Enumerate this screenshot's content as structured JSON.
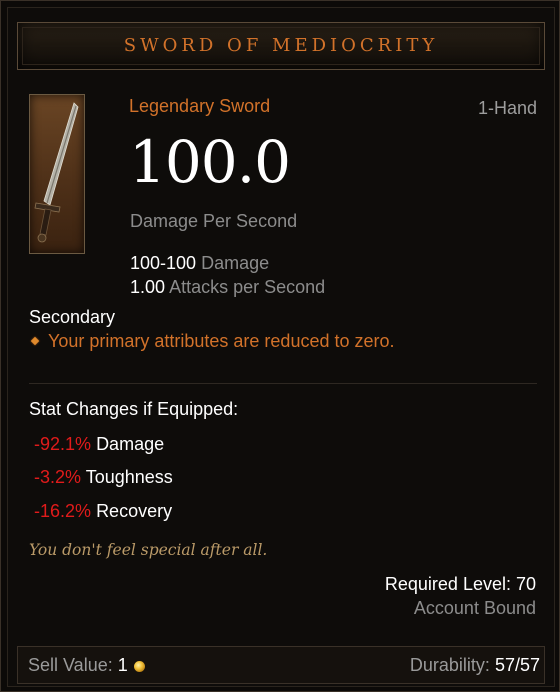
{
  "tooltip": {
    "title": "Sword of Mediocrity",
    "item_type": "Legendary Sword",
    "slot": "1-Hand",
    "icon": "sword-icon",
    "dps_value": "100.0",
    "dps_label": "Damage Per Second",
    "damage_value": "100-100",
    "damage_label": "Damage",
    "aps_value": "1.00",
    "aps_label": "Attacks per Second",
    "secondary_heading": "Secondary",
    "affix_text": "Your primary attributes are reduced to zero.",
    "stat_changes_heading": "Stat Changes if Equipped:",
    "stat_changes": [
      {
        "value": "-92.1%",
        "label": "Damage"
      },
      {
        "value": "-3.2%",
        "label": "Toughness"
      },
      {
        "value": "-16.2%",
        "label": "Recovery"
      }
    ],
    "flavor_text": "You don't feel special after all.",
    "required_level": "Required Level: 70",
    "account_bound": "Account Bound",
    "sell_label": "Sell Value:",
    "sell_value": "1",
    "currency_icon": "gold-coin-icon",
    "durability_label": "Durability:",
    "durability_value": "57/57"
  },
  "colors": {
    "legendary": "#d2722a",
    "negative": "#e01b1b",
    "muted": "#8c8c8c",
    "flavor": "#ba9a68"
  }
}
